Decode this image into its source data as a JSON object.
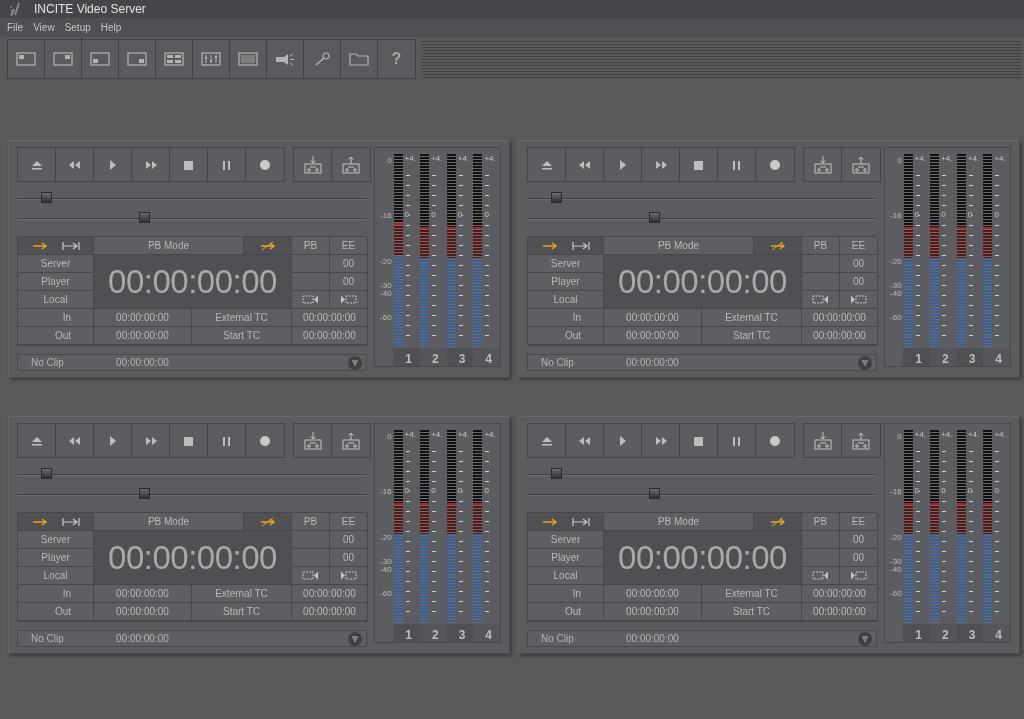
{
  "window": {
    "title": "INCITE Video Server"
  },
  "menu": [
    "File",
    "View",
    "Setup",
    "Help"
  ],
  "toolbar": {
    "help_label": "?"
  },
  "panels": [
    {
      "sliders": [
        {
          "level": 0.07
        },
        {
          "level": 0.36
        }
      ],
      "mode_label": "PB Mode",
      "pb": "PB",
      "ee": "EE",
      "sources": [
        "Server",
        "Player",
        "Local"
      ],
      "timecode": "00:00:00:00",
      "counts": [
        "00",
        "00"
      ],
      "in_label": "In",
      "in_tc": "00:00:00:00",
      "out_label": "Out",
      "out_tc": "00:00:00:00",
      "external_label": "External TC",
      "external_tc": "00:00:00:00",
      "start_label": "Start TC",
      "start_tc": "00:00:00:00",
      "clip": "No Clip",
      "clip_tc": "00:00:00:00",
      "meter": {
        "scale": [
          "0",
          "-16",
          "-20",
          "-30",
          "-40",
          "-60"
        ],
        "channels": [
          {
            "label": "1",
            "top": "+4.",
            "zero": "0",
            "level": 0.64
          },
          {
            "label": "2",
            "top": "+4.",
            "zero": "0",
            "level": 0.62
          },
          {
            "label": "3",
            "top": "+4.",
            "zero": "0",
            "level": 0.62
          },
          {
            "label": "4",
            "top": "+4.",
            "zero": "0",
            "level": 0.62
          }
        ]
      }
    },
    {
      "sliders": [
        {
          "level": 0.07
        },
        {
          "level": 0.36
        }
      ],
      "mode_label": "PB Mode",
      "pb": "PB",
      "ee": "EE",
      "sources": [
        "Server",
        "Player",
        "Local"
      ],
      "timecode": "00:00:00:00",
      "counts": [
        "00",
        "00"
      ],
      "in_label": "In",
      "in_tc": "00:00:00:00",
      "out_label": "Out",
      "out_tc": "00:00:00:00",
      "external_label": "External TC",
      "external_tc": "00:00:00:00",
      "start_label": "Start TC",
      "start_tc": "00:00:00:00",
      "clip": "No Clip",
      "clip_tc": "00:00:00:00",
      "meter": {
        "scale": [
          "0",
          "-16",
          "-20",
          "-30",
          "-40",
          "-60"
        ],
        "channels": [
          {
            "label": "1",
            "top": "+4.",
            "zero": "0",
            "level": 0.62
          },
          {
            "label": "2",
            "top": "+4.",
            "zero": "0",
            "level": 0.62
          },
          {
            "label": "3",
            "top": "+4.",
            "zero": "0",
            "level": 0.62
          },
          {
            "label": "4",
            "top": "+4.",
            "zero": "0",
            "level": 0.62
          }
        ]
      }
    },
    {
      "sliders": [
        {
          "level": 0.07
        },
        {
          "level": 0.36
        }
      ],
      "mode_label": "PB Mode",
      "pb": "PB",
      "ee": "EE",
      "sources": [
        "Server",
        "Player",
        "Local"
      ],
      "timecode": "00:00:00:00",
      "counts": [
        "00",
        "00"
      ],
      "in_label": "In",
      "in_tc": "00:00:00:00",
      "out_label": "Out",
      "out_tc": "00:00:00:00",
      "external_label": "External TC",
      "external_tc": "00:00:00:00",
      "start_label": "Start TC",
      "start_tc": "00:00:00:00",
      "clip": "No Clip",
      "clip_tc": "00:00:00:00",
      "meter": {
        "scale": [
          "0",
          "-16",
          "-20",
          "-30",
          "-40",
          "-60"
        ],
        "channels": [
          {
            "label": "1",
            "top": "+4.",
            "zero": "0",
            "level": 0.62
          },
          {
            "label": "2",
            "top": "+4.",
            "zero": "0",
            "level": 0.62
          },
          {
            "label": "3",
            "top": "+4.",
            "zero": "0",
            "level": 0.62
          },
          {
            "label": "4",
            "top": "+4.",
            "zero": "0",
            "level": 0.62
          }
        ]
      }
    },
    {
      "sliders": [
        {
          "level": 0.07
        },
        {
          "level": 0.36
        }
      ],
      "mode_label": "PB Mode",
      "pb": "PB",
      "ee": "EE",
      "sources": [
        "Server",
        "Player",
        "Local"
      ],
      "timecode": "00:00:00:00",
      "counts": [
        "00",
        "00"
      ],
      "in_label": "In",
      "in_tc": "00:00:00:00",
      "out_label": "Out",
      "out_tc": "00:00:00:00",
      "external_label": "External TC",
      "external_tc": "00:00:00:00",
      "start_label": "Start TC",
      "start_tc": "00:00:00:00",
      "clip": "No Clip",
      "clip_tc": "00:00:00:00",
      "meter": {
        "scale": [
          "0",
          "-16",
          "-20",
          "-30",
          "-40",
          "-60"
        ],
        "channels": [
          {
            "label": "1",
            "top": "+4.",
            "zero": "0",
            "level": 0.62
          },
          {
            "label": "2",
            "top": "+4.",
            "zero": "0",
            "level": 0.62
          },
          {
            "label": "3",
            "top": "+4.",
            "zero": "0",
            "level": 0.62
          },
          {
            "label": "4",
            "top": "+4.",
            "zero": "0",
            "level": 0.62
          }
        ]
      }
    }
  ]
}
